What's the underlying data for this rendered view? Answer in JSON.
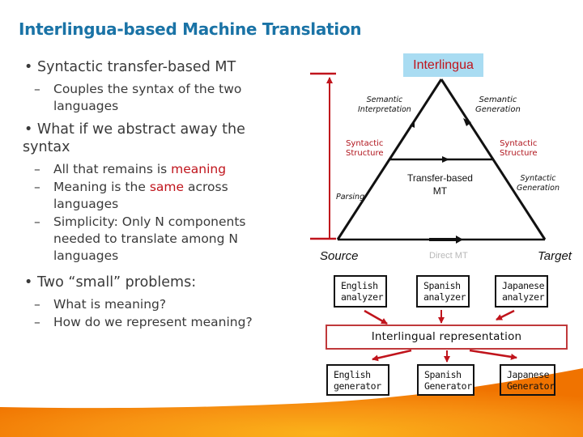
{
  "slide": {
    "title": "Interlingua-based Machine Translation"
  },
  "bullets": [
    {
      "text": "Syntactic transfer-based MT",
      "subs": [
        {
          "text": "Couples the syntax of the two",
          "text2": "languages"
        }
      ]
    },
    {
      "text": "What if we abstract away the",
      "text2": "syntax",
      "subs": [
        {
          "pre": "All that remains is ",
          "highlight": "meaning",
          "post": ""
        },
        {
          "pre": "Meaning is the ",
          "highlight": "same",
          "post": " across",
          "text2": "languages"
        },
        {
          "text": "Simplicity: Only N components",
          "text2": "needed to translate among N",
          "text3": "languages"
        }
      ]
    },
    {
      "text": "Two “small” problems:",
      "subs": [
        {
          "text": "What is meaning?"
        },
        {
          "text": "How do we represent meaning?"
        }
      ]
    }
  ],
  "triangle": {
    "apex_label": "Interlingua",
    "semantic_interpretation": [
      "Semantic",
      "Interpretation"
    ],
    "semantic_generation": [
      "Semantic",
      "Generation"
    ],
    "syntactic_structure_left": [
      "Syntactic",
      "Structure"
    ],
    "syntactic_structure_right": [
      "Syntactic",
      "Structure"
    ],
    "transfer_based": [
      "Transfer-based",
      "MT"
    ],
    "parsing": "Parsing",
    "syntactic_generation": [
      "Syntactic",
      "Generation"
    ],
    "source": "Source",
    "target": "Target",
    "direct_mt": "Direct MT"
  },
  "pipeline": {
    "analyzers": [
      {
        "line1": "English",
        "line2": "analyzer"
      },
      {
        "line1": "Spanish",
        "line2": "analyzer"
      },
      {
        "line1": "Japanese",
        "line2": "analyzer"
      }
    ],
    "representation": "Interlingual representation",
    "generators": [
      {
        "line1": "English",
        "line2": "generator"
      },
      {
        "line1": "Spanish",
        "line2": "Generator"
      },
      {
        "line1": "Japanese",
        "line2": "Generator"
      }
    ]
  },
  "colors": {
    "title": "#1a73a6",
    "accent_red": "#c0141c",
    "interlingua_bg": "#a9dcf2",
    "swoosh_orange": "#f07d00",
    "swoosh_yellow": "#fbb21a"
  }
}
